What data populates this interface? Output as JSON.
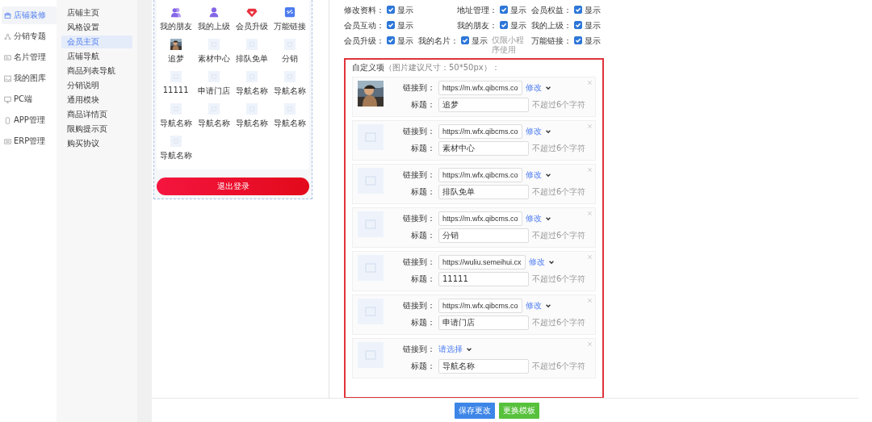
{
  "sidebar": {
    "items": [
      {
        "label": "店铺装修",
        "selected": true
      },
      {
        "label": "分销专题",
        "selected": false
      },
      {
        "label": "名片管理",
        "selected": false
      },
      {
        "label": "我的图库",
        "selected": false
      },
      {
        "label": "PC端",
        "selected": false
      },
      {
        "label": "APP管理",
        "selected": false
      },
      {
        "label": "ERP管理",
        "selected": false
      }
    ]
  },
  "submenu": {
    "items": [
      {
        "label": "店铺主页",
        "selected": false
      },
      {
        "label": "风格设置",
        "selected": false
      },
      {
        "label": "会员主页",
        "selected": true
      },
      {
        "label": "店铺导航",
        "selected": false
      },
      {
        "label": "商品列表导航",
        "selected": false
      },
      {
        "label": "分销说明",
        "selected": false
      },
      {
        "label": "通用模块",
        "selected": false
      },
      {
        "label": "商品详情页",
        "selected": false
      },
      {
        "label": "限购提示页",
        "selected": false
      },
      {
        "label": "购买协议",
        "selected": false
      }
    ]
  },
  "preview": {
    "nav": [
      {
        "label": "我的朋友"
      },
      {
        "label": "我的上级"
      },
      {
        "label": "会员升级"
      },
      {
        "label": "万能链接"
      },
      {
        "label": "追梦"
      },
      {
        "label": "素材中心"
      },
      {
        "label": "排队免单"
      },
      {
        "label": "分销"
      },
      {
        "label": "11111"
      },
      {
        "label": "申请门店"
      },
      {
        "label": "导航名称"
      },
      {
        "label": "导航名称"
      },
      {
        "label": "导航名称"
      },
      {
        "label": "导航名称"
      },
      {
        "label": "导航名称"
      },
      {
        "label": "导航名称"
      },
      {
        "label": "导航名称"
      }
    ],
    "logout": "退出登录"
  },
  "settings": {
    "toggles": [
      {
        "label": "修改资料：",
        "checked": true,
        "value": "显示"
      },
      {
        "label": "地址管理：",
        "checked": true,
        "value": "显示"
      },
      {
        "label": "会员权益：",
        "checked": true,
        "value": "显示"
      },
      {
        "label": "会员互动：",
        "checked": true,
        "value": "显示"
      },
      {
        "label": "我的朋友：",
        "checked": true,
        "value": "显示"
      },
      {
        "label": "我的上级：",
        "checked": true,
        "value": "显示"
      },
      {
        "label": "会员升级：",
        "checked": true,
        "value": "显示"
      },
      {
        "label": "我的名片：",
        "checked": true,
        "value": "显示",
        "note": "仅限小程序使用"
      },
      {
        "label": "万能链接：",
        "checked": true,
        "value": "显示"
      }
    ]
  },
  "custom": {
    "title": "自定义项",
    "hint": "（图片建议尺寸：50*50px）：",
    "items": [
      {
        "kind": "url",
        "link_label": "链接到：",
        "link": "https://m.wfx.qibcms.co",
        "edit": "修改",
        "title_label": "标题：",
        "title": "追梦",
        "limit": "不超过6个字符"
      },
      {
        "kind": "url",
        "link_label": "链接到：",
        "link": "https://m.wfx.qibcms.co",
        "edit": "修改",
        "title_label": "标题：",
        "title": "素材中心",
        "limit": "不超过6个字符"
      },
      {
        "kind": "url",
        "link_label": "链接到：",
        "link": "https://m.wfx.qibcms.co",
        "edit": "修改",
        "title_label": "标题：",
        "title": "排队免单",
        "limit": "不超过6个字符"
      },
      {
        "kind": "url",
        "link_label": "链接到：",
        "link": "https://m.wfx.qibcms.co",
        "edit": "修改",
        "title_label": "标题：",
        "title": "分销",
        "limit": "不超过6个字符"
      },
      {
        "kind": "url",
        "link_label": "链接到：",
        "link": "https://wuliu.semeihui.cx",
        "edit": "修改",
        "title_label": "标题：",
        "title": "11111",
        "limit": "不超过6个字符"
      },
      {
        "kind": "url",
        "link_label": "链接到：",
        "link": "https://m.wfx.qibcms.co",
        "edit": "修改",
        "title_label": "标题：",
        "title": "申请门店",
        "limit": "不超过6个字符"
      },
      {
        "kind": "choose",
        "link_label": "链接到：",
        "edit": "请选择",
        "title_label": "标题：",
        "title": "导航名称",
        "limit": "不超过6个字符"
      }
    ]
  },
  "footer": {
    "buttons": [
      {
        "label": "保存更改"
      },
      {
        "label": "更换模板"
      }
    ]
  }
}
